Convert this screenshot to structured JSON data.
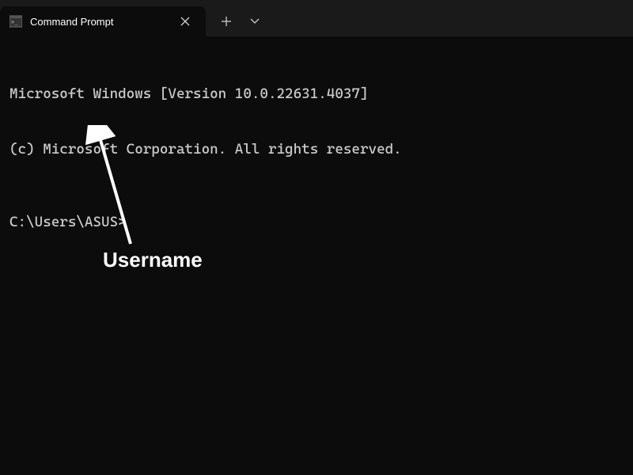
{
  "tab": {
    "title": "Command Prompt"
  },
  "terminal": {
    "line1": "Microsoft Windows [Version 10.0.22631.4037]",
    "line2": "(c) Microsoft Corporation. All rights reserved.",
    "prompt": "C:\\Users\\ASUS>"
  },
  "annotation": {
    "label": "Username"
  }
}
